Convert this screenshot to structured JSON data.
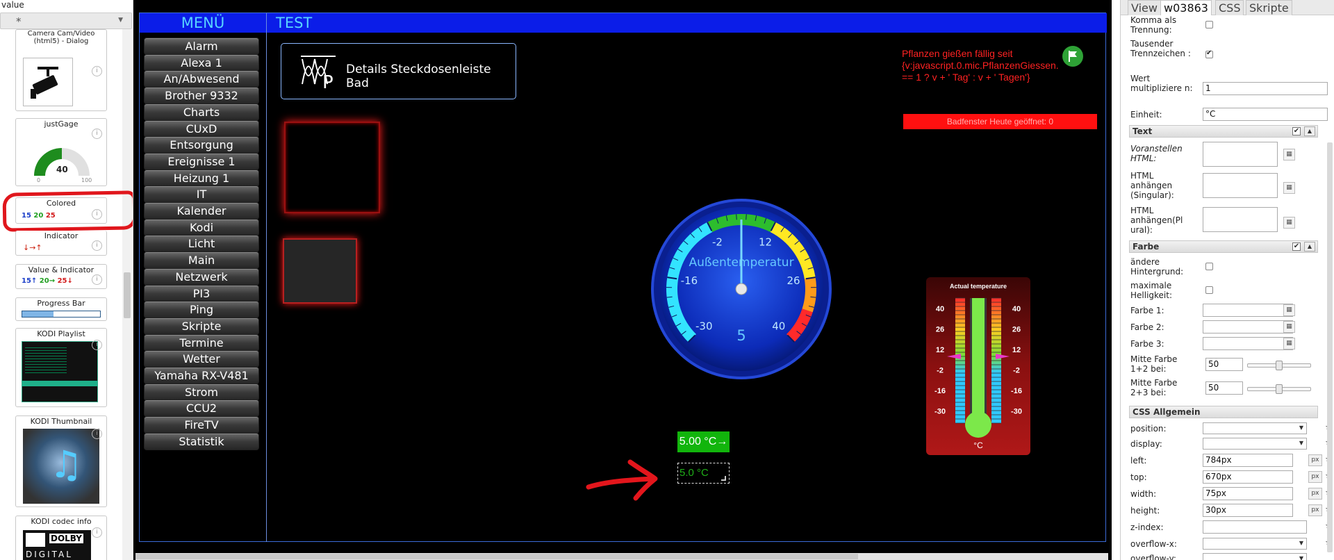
{
  "palette": {
    "top_value": "value",
    "filter_value": "*",
    "camera": {
      "title": "Camera Cam/Video (html5) - Dialog"
    },
    "justgage": {
      "title": "justGage",
      "value": "40",
      "min": "0",
      "max": "100"
    },
    "colored": {
      "title": "Colored",
      "v1": "15",
      "v2": "20",
      "v3": "25"
    },
    "indicator": {
      "title": "Indicator",
      "text": "↓→↑"
    },
    "value_indicator": {
      "title": "Value & Indicator",
      "text1": "15↑",
      "text2": "20→",
      "text3": "25↓"
    },
    "progress": {
      "title": "Progress Bar",
      "level": 0.4
    },
    "kodi_playlist": {
      "title": "KODI Playlist"
    },
    "kodi_thumb": {
      "title": "KODI Thumbnail"
    },
    "kodi_codec": {
      "title": "KODI codec info",
      "dolby_line1": "DOLBY",
      "dolby_line2": "DIGITAL"
    }
  },
  "view": {
    "menu_title": "MENÜ",
    "page_title": "TEST",
    "menu_items": [
      "Alarm",
      "Alexa 1",
      "An/Abwesend",
      "Brother 9332",
      "Charts",
      "CUxD",
      "Entsorgung",
      "Ereignisse 1",
      "Heizung 1",
      "IT",
      "Kalender",
      "Kodi",
      "Licht",
      "Main",
      "Netzwerk",
      "PI3",
      "Ping",
      "Skripte",
      "Termine",
      "Wetter",
      "Yamaha RX-V481",
      "Strom",
      "CCU2",
      "FireTV",
      "Statistik"
    ],
    "details_button": "Details Steckdosenleiste Bad",
    "alert_text": "Pflanzen gießen fällig seit {v:javascript.0.mic.PflanzenGiessen. == 1 ? v + ' Tag' : v + ' Tagen'}",
    "bath_window": "Badfenster Heute geöffnet: 0",
    "gauge": {
      "label": "Außentemperatur",
      "value": 5,
      "ticks": [
        "-30",
        "-16",
        "-2",
        "12",
        "26",
        "40"
      ]
    },
    "thermo": {
      "title": "Actual temperature",
      "unit": "°C",
      "ticks": [
        "40",
        "26",
        "12",
        "-2",
        "-16",
        "-30"
      ]
    },
    "value_green": "5.00 °C→",
    "value_selected": "5.0 °C",
    "colors": {
      "accent": "#0b1de8",
      "header_text": "#58d4ff",
      "alert": "#ff2222",
      "green": "#12b50c"
    }
  },
  "props": {
    "tabs": [
      "View",
      "w03863",
      "CSS",
      "Skripte"
    ],
    "active_tab": "w03863",
    "komma": "Komma als Trennung:",
    "tausender": "Tausender Trennzeichen :",
    "multipl": "Wert multipliziere n:",
    "multipl_value": "1",
    "einheit": "Einheit:",
    "einheit_value": "°C",
    "sect_text": "Text",
    "voranstellen": "Voranstellen HTML:",
    "anhaengen_s": "HTML anhängen (Singular):",
    "anhaengen_p": "HTML anhängen(Pl ural):",
    "sect_farbe": "Farbe",
    "andere_bg": "ändere Hintergrund:",
    "max_hell": "maximale Helligkeit:",
    "farbe1": "Farbe 1:",
    "farbe2": "Farbe 2:",
    "farbe3": "Farbe 3:",
    "mitte12": "Mitte Farbe 1+2 bei:",
    "mitte12_value": "50",
    "mitte23": "Mitte Farbe 2+3 bei:",
    "mitte23_value": "50",
    "sect_css": "CSS Allgemein",
    "position": "position:",
    "display": "display:",
    "left": "left:",
    "left_value": "784px",
    "top": "top:",
    "top_value": "670px",
    "width": "width:",
    "width_value": "75px",
    "height": "height:",
    "height_value": "30px",
    "zindex": "z-index:",
    "overflowx": "overflow-x:",
    "overflowy": "overflow-y:",
    "px": "px"
  }
}
